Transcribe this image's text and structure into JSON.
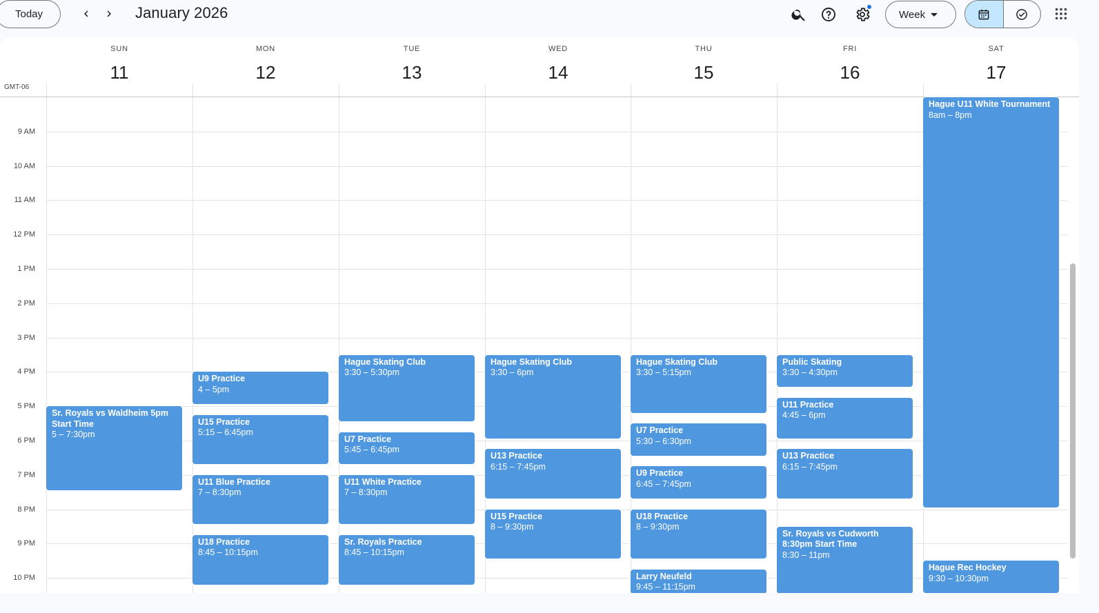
{
  "toolbar": {
    "today_label": "Today",
    "month_title": "January 2026",
    "view_label": "Week"
  },
  "header": {
    "timezone": "GMT-06",
    "days": [
      {
        "dow": "SUN",
        "date": "11"
      },
      {
        "dow": "MON",
        "date": "12"
      },
      {
        "dow": "TUE",
        "date": "13"
      },
      {
        "dow": "WED",
        "date": "14"
      },
      {
        "dow": "THU",
        "date": "15"
      },
      {
        "dow": "FRI",
        "date": "16"
      },
      {
        "dow": "SAT",
        "date": "17"
      }
    ]
  },
  "hours": [
    "9 AM",
    "10 AM",
    "11 AM",
    "12 PM",
    "1 PM",
    "2 PM",
    "3 PM",
    "4 PM",
    "5 PM",
    "6 PM",
    "7 PM",
    "8 PM",
    "9 PM",
    "10 PM"
  ],
  "events": [
    {
      "day": 0,
      "start": 17.0,
      "end": 19.5,
      "title": "Sr. Royals vs Waldheim 5pm Start Time",
      "time": "5 – 7:30pm"
    },
    {
      "day": 1,
      "start": 16.0,
      "end": 17.0,
      "title": "U9 Practice",
      "time": "4 – 5pm"
    },
    {
      "day": 1,
      "start": 17.25,
      "end": 18.75,
      "title": "U15 Practice",
      "time": "5:15 – 6:45pm"
    },
    {
      "day": 1,
      "start": 19.0,
      "end": 20.5,
      "title": "U11 Blue Practice",
      "time": "7 – 8:30pm"
    },
    {
      "day": 1,
      "start": 20.75,
      "end": 22.25,
      "title": "U18 Practice",
      "time": "8:45 – 10:15pm"
    },
    {
      "day": 2,
      "start": 15.5,
      "end": 17.5,
      "title": "Hague Skating Club",
      "time": "3:30 – 5:30pm"
    },
    {
      "day": 2,
      "start": 17.75,
      "end": 18.75,
      "title": "U7 Practice",
      "time": "5:45 – 6:45pm"
    },
    {
      "day": 2,
      "start": 19.0,
      "end": 20.5,
      "title": "U11 White Practice",
      "time": "7 – 8:30pm"
    },
    {
      "day": 2,
      "start": 20.75,
      "end": 22.25,
      "title": "Sr. Royals Practice",
      "time": "8:45 – 10:15pm"
    },
    {
      "day": 3,
      "start": 15.5,
      "end": 18.0,
      "title": "Hague Skating Club",
      "time": "3:30 – 6pm"
    },
    {
      "day": 3,
      "start": 18.25,
      "end": 19.75,
      "title": "U13 Practice",
      "time": "6:15 – 7:45pm"
    },
    {
      "day": 3,
      "start": 20.0,
      "end": 21.5,
      "title": "U15 Practice",
      "time": "8 – 9:30pm"
    },
    {
      "day": 4,
      "start": 15.5,
      "end": 17.25,
      "title": "Hague Skating Club",
      "time": "3:30 – 5:15pm"
    },
    {
      "day": 4,
      "start": 17.5,
      "end": 18.5,
      "title": "U7 Practice",
      "time": "5:30 – 6:30pm"
    },
    {
      "day": 4,
      "start": 18.75,
      "end": 19.75,
      "title": "U9 Practice",
      "time": "6:45 – 7:45pm"
    },
    {
      "day": 4,
      "start": 20.0,
      "end": 21.5,
      "title": "U18 Practice",
      "time": "8 – 9:30pm"
    },
    {
      "day": 4,
      "start": 21.75,
      "end": 23.25,
      "title": "Larry Neufeld",
      "time": "9:45 – 11:15pm"
    },
    {
      "day": 5,
      "start": 15.5,
      "end": 16.5,
      "title": "Public Skating",
      "time": "3:30 – 4:30pm"
    },
    {
      "day": 5,
      "start": 16.75,
      "end": 18.0,
      "title": "U11 Practice",
      "time": "4:45 – 6pm"
    },
    {
      "day": 5,
      "start": 18.25,
      "end": 19.75,
      "title": "U13 Practice",
      "time": "6:15 – 7:45pm"
    },
    {
      "day": 5,
      "start": 20.5,
      "end": 23.0,
      "title": "Sr. Royals vs Cudworth 8:30pm Start Time",
      "time": "8:30 – 11pm"
    },
    {
      "day": 6,
      "start": 8.0,
      "end": 20.0,
      "title": "Hague U11 White Tournament",
      "time": "8am – 8pm"
    },
    {
      "day": 6,
      "start": 21.5,
      "end": 22.5,
      "title": "Hague Rec Hockey",
      "time": "9:30 – 10:30pm"
    }
  ],
  "colors": {
    "event": "#4f98e0",
    "accent": "#1a73e8",
    "active_view": "#c2e7ff"
  },
  "icons": [
    "chevron-left-icon",
    "chevron-right-icon",
    "search-icon",
    "help-icon",
    "settings-icon",
    "calendar-icon",
    "task-check-icon",
    "apps-grid-icon"
  ]
}
